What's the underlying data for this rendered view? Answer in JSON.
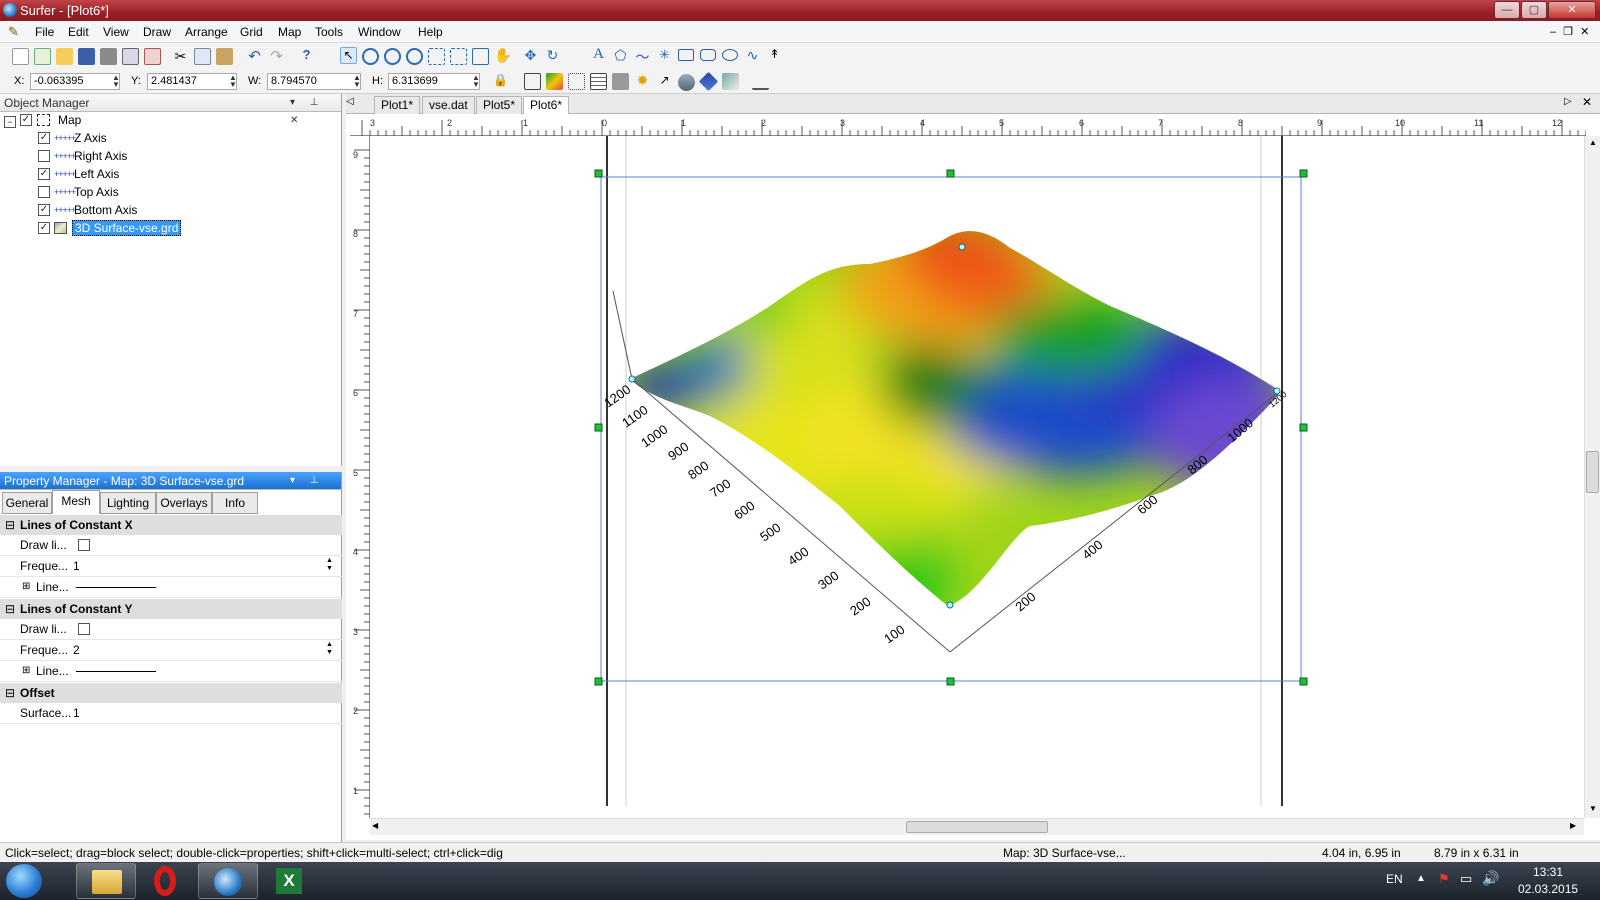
{
  "window": {
    "title": "Surfer - [Plot6*]",
    "controls": {
      "minimize": "—",
      "maximize": "▢",
      "close": "✕"
    },
    "doc_controls": "–  ❐  ✕"
  },
  "menu": [
    "File",
    "Edit",
    "View",
    "Draw",
    "Arrange",
    "Grid",
    "Map",
    "Tools",
    "Window",
    "Help"
  ],
  "coords": {
    "x_label": "X:",
    "x_value": "-0.063395",
    "y_label": "Y:",
    "y_value": "2.481437",
    "w_label": "W:",
    "w_value": "8.794570",
    "h_label": "H:",
    "h_value": "6.313699"
  },
  "object_manager": {
    "title": "Object Manager",
    "items": [
      {
        "label": "Map",
        "checked": true
      },
      {
        "label": "Z Axis",
        "checked": true
      },
      {
        "label": "Right Axis",
        "checked": false
      },
      {
        "label": "Left Axis",
        "checked": true
      },
      {
        "label": "Top Axis",
        "checked": false
      },
      {
        "label": "Bottom Axis",
        "checked": true
      },
      {
        "label": "3D Surface-vse.grd",
        "checked": true
      }
    ]
  },
  "property_manager": {
    "title": "Property Manager - Map: 3D Surface-vse.grd",
    "tabs": [
      "General",
      "Mesh",
      "Lighting",
      "Overlays",
      "Info"
    ],
    "sections": [
      {
        "title": "Lines of Constant X",
        "rows": [
          {
            "label": "Draw li...",
            "value": ""
          },
          {
            "label": "Freque...",
            "value": "1"
          },
          {
            "label": "Line...",
            "value": ""
          }
        ]
      },
      {
        "title": "Lines of Constant Y",
        "rows": [
          {
            "label": "Draw li...",
            "value": ""
          },
          {
            "label": "Freque...",
            "value": "2"
          },
          {
            "label": "Line...",
            "value": ""
          }
        ]
      },
      {
        "title": "Offset",
        "rows": [
          {
            "label": "Surface...",
            "value": "1"
          }
        ]
      }
    ]
  },
  "doc_tabs": [
    "Plot1*",
    "vse.dat",
    "Plot5*",
    "Plot6*"
  ],
  "rulers": {
    "h": [
      "3",
      "2",
      "1",
      "0",
      "1",
      "2",
      "3",
      "4",
      "5",
      "6",
      "7",
      "8",
      "9",
      "10",
      "11",
      "12"
    ],
    "v": [
      "9",
      "8",
      "7",
      "6",
      "5",
      "4",
      "3",
      "2",
      "1"
    ]
  },
  "plot": {
    "left_axis_labels": [
      "1200",
      "1100",
      "1000",
      "900",
      "800",
      "700",
      "600",
      "500",
      "400",
      "300",
      "200",
      "100"
    ],
    "right_axis_labels": [
      "200",
      "400",
      "600",
      "800",
      "1000",
      "1200"
    ]
  },
  "status": {
    "hint": "Click=select; drag=block select; double-click=properties; shift+click=multi-select; ctrl+click=dig",
    "selection": "Map: 3D Surface-vse...",
    "position": "4.04 in, 6.95 in",
    "size": "8.79 in x 6.31 in"
  },
  "taskbar": {
    "lang": "EN",
    "time": "13:31",
    "date": "02.03.2015"
  }
}
